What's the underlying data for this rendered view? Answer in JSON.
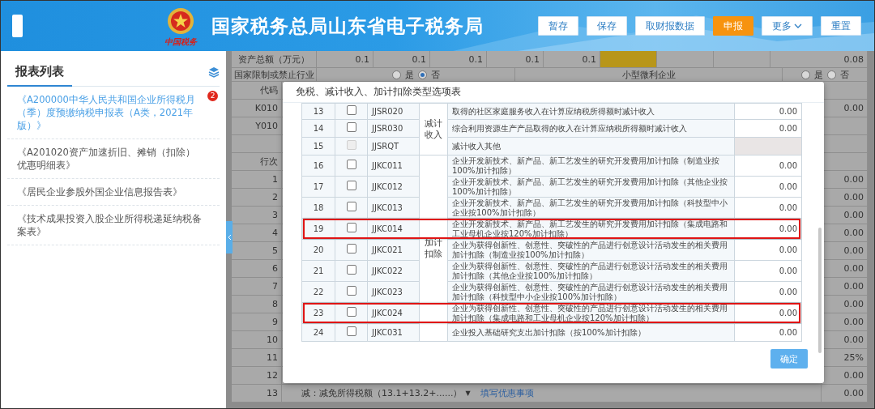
{
  "header": {
    "logo_text": "中国税务",
    "title": "国家税务总局山东省电子税务局",
    "buttons": [
      {
        "label": "暂存",
        "kind": "normal"
      },
      {
        "label": "保存",
        "kind": "normal"
      },
      {
        "label": "取财报数据",
        "kind": "normal"
      },
      {
        "label": "申报",
        "kind": "primary"
      },
      {
        "label": "更多",
        "kind": "dropdown"
      },
      {
        "label": "重置",
        "kind": "normal"
      }
    ]
  },
  "sidebar": {
    "title": "报表列表",
    "items": [
      {
        "label": "《A200000中华人民共和国企业所得税月（季）度预缴纳税申报表（A类，2021年版）》",
        "selected": true,
        "badge": "2"
      },
      {
        "label": "《A201020资产加速折旧、摊销（扣除）优惠明细表》",
        "selected": false
      },
      {
        "label": "《居民企业参股外国企业信息报告表》",
        "selected": false
      },
      {
        "label": "《技术成果投资入股企业所得税递延纳税备案表》",
        "selected": false
      }
    ]
  },
  "form": {
    "asset_row": {
      "label": "资产总额（万元）",
      "cells": [
        {
          "kind": "value",
          "value": "0.1"
        },
        {
          "kind": "value",
          "value": "0.1"
        },
        {
          "kind": "value",
          "value": "0.1"
        },
        {
          "kind": "value",
          "value": "0.1"
        },
        {
          "kind": "value",
          "value": "0.1"
        },
        {
          "kind": "filled"
        },
        {
          "kind": "empty"
        },
        {
          "kind": "empty"
        },
        {
          "kind": "value",
          "value": "0.08"
        }
      ]
    },
    "industry_row": {
      "label": "国家限制或禁止行业",
      "options": [
        {
          "label": "是",
          "selected": false
        },
        {
          "label": "否",
          "selected": true
        }
      ],
      "label_2": "小型微利企业",
      "options_2": [
        {
          "label": "是",
          "selected": false
        },
        {
          "label": "否",
          "selected": false
        }
      ]
    },
    "rows": [
      {
        "label": "代码"
      },
      {
        "label": "K010",
        "value": "0.00"
      },
      {
        "label": "Y010"
      },
      {},
      {
        "label": "行次"
      },
      {
        "label": "1",
        "value": "0.00"
      },
      {
        "label": "2",
        "value": "0.00"
      },
      {
        "label": "3",
        "value": "0.00"
      },
      {
        "label": "4",
        "value": "0.00"
      },
      {
        "label": "5",
        "value": "0.00"
      },
      {
        "label": "6",
        "value": "0.00"
      },
      {
        "label": "7",
        "value": "0.00"
      },
      {
        "label": "8",
        "value": "0.00"
      },
      {
        "label": "9",
        "value": "0.00"
      },
      {
        "label": "10",
        "value": "0.00"
      },
      {
        "label": "11",
        "value": "25%"
      },
      {
        "label": "12",
        "value": "0.00"
      },
      {
        "label": "13",
        "value": "0.00",
        "item": "减：减免所得税额（13.1+13.2+......）",
        "caret": "▼",
        "link": "填写优惠事项"
      }
    ]
  },
  "dialog": {
    "title": "免税、减计收入、加计扣除类型选项表",
    "groups": [
      {
        "label": "减计收入",
        "rows": [
          {
            "num": "13",
            "checked": false,
            "disabled": false,
            "code": "JJSR020",
            "description": "取得的社区家庭服务收入在计算应纳税所得额时减计收入",
            "amount": "0.00",
            "highlighted": false
          },
          {
            "num": "14",
            "checked": false,
            "disabled": false,
            "code": "JJSR030",
            "description": "综合利用资源生产产品取得的收入在计算应纳税所得额时减计收入",
            "amount": "0.00",
            "highlighted": false
          },
          {
            "num": "15",
            "checked": false,
            "disabled": true,
            "code": "JJSRQT",
            "description": "减计收入其他",
            "highlighted": false
          }
        ]
      },
      {
        "label": "加计扣除",
        "rows": [
          {
            "num": "16",
            "checked": false,
            "disabled": false,
            "code": "JJKC011",
            "description": "企业开发新技术、新产品、新工艺发生的研究开发费用加计扣除（制造业按100%加计扣除）",
            "amount": "0.00",
            "highlighted": false
          },
          {
            "num": "17",
            "checked": false,
            "disabled": false,
            "code": "JJKC012",
            "description": "企业开发新技术、新产品、新工艺发生的研究开发费用加计扣除（其他企业按100%加计扣除）",
            "amount": "0.00",
            "highlighted": false
          },
          {
            "num": "18",
            "checked": false,
            "disabled": false,
            "code": "JJKC013",
            "description": "企业开发新技术、新产品、新工艺发生的研究开发费用加计扣除（科技型中小企业按100%加计扣除）",
            "amount": "0.00",
            "highlighted": false
          },
          {
            "num": "19",
            "checked": false,
            "disabled": false,
            "code": "JJKC014",
            "description": "企业开发新技术、新产品、新工艺发生的研究开发费用加计扣除（集成电路和工业母机企业按120%加计扣除）",
            "amount": "0.00",
            "highlighted": true
          },
          {
            "num": "20",
            "checked": false,
            "disabled": false,
            "code": "JJKC021",
            "description": "企业为获得创新性、创意性、突破性的产品进行创意设计活动发生的相关费用加计扣除（制造业按100%加计扣除）",
            "amount": "0.00",
            "highlighted": false
          },
          {
            "num": "21",
            "checked": false,
            "disabled": false,
            "code": "JJKC022",
            "description": "企业为获得创新性、创意性、突破性的产品进行创意设计活动发生的相关费用加计扣除（其他企业按100%加计扣除）",
            "amount": "0.00",
            "highlighted": false
          },
          {
            "num": "22",
            "checked": false,
            "disabled": false,
            "code": "JJKC023",
            "description": "企业为获得创新性、创意性、突破性的产品进行创意设计活动发生的相关费用加计扣除（科技型中小企业按100%加计扣除）",
            "amount": "0.00",
            "highlighted": false
          },
          {
            "num": "23",
            "checked": false,
            "disabled": false,
            "code": "JJKC024",
            "description": "企业为获得创新性、创意性、突破性的产品进行创意设计活动发生的相关费用加计扣除（集成电路和工业母机企业按120%加计扣除）",
            "amount": "0.00",
            "highlighted": true
          },
          {
            "num": "24",
            "checked": false,
            "disabled": false,
            "code": "JJKC031",
            "description": "企业投入基础研究支出加计扣除（按100%加计扣除）",
            "amount": "0.00",
            "highlighted": false
          }
        ]
      }
    ],
    "confirm": "确定"
  }
}
